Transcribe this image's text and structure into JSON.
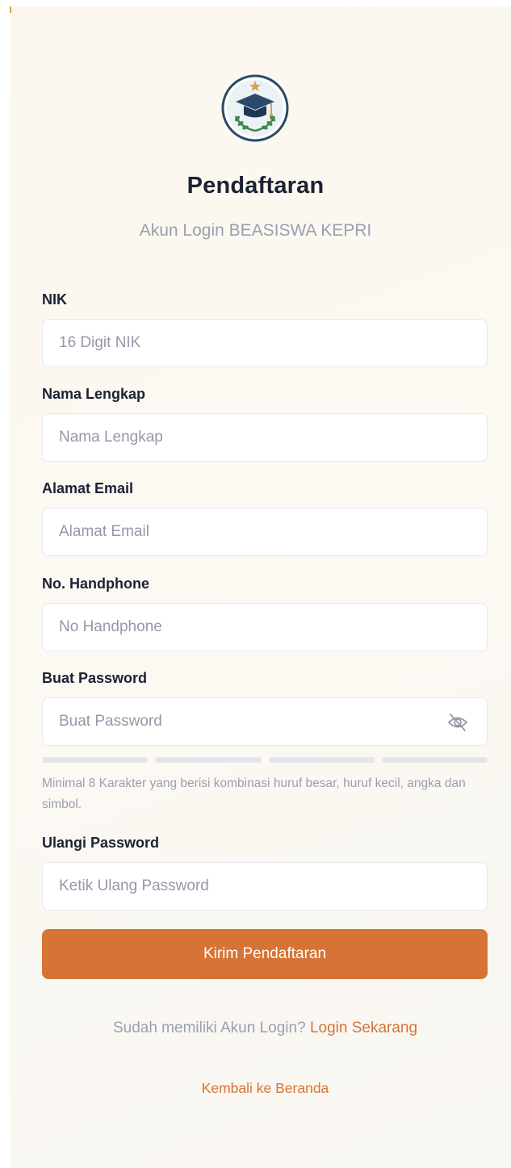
{
  "header": {
    "title": "Pendaftaran",
    "subtitle": "Akun Login BEASISWA KEPRI"
  },
  "form": {
    "nik": {
      "label": "NIK",
      "placeholder": "16 Digit NIK",
      "value": ""
    },
    "name": {
      "label": "Nama Lengkap",
      "placeholder": "Nama Lengkap",
      "value": ""
    },
    "email": {
      "label": "Alamat Email",
      "placeholder": "Alamat Email",
      "value": ""
    },
    "phone": {
      "label": "No. Handphone",
      "placeholder": "No Handphone",
      "value": ""
    },
    "password": {
      "label": "Buat Password",
      "placeholder": "Buat Password",
      "value": "",
      "toggle_icon": "eye-off-icon",
      "strength_level": 0,
      "strength_segments": 4,
      "hint": "Minimal 8 Karakter yang berisi kombinasi huruf besar, huruf kecil, angka dan simbol."
    },
    "confirm_password": {
      "label": "Ulangi Password",
      "placeholder": "Ketik Ulang Password",
      "value": ""
    },
    "submit_label": "Kirim Pendaftaran"
  },
  "footer": {
    "login_prompt": "Sudah memiliki Akun Login?",
    "login_link": "Login Sekarang",
    "back_link": "Kembali ke Beranda"
  },
  "colors": {
    "accent": "#d67435",
    "title": "#1c2133",
    "muted": "#9a9fb0",
    "logo_navy": "#2b4a6b",
    "logo_green": "#3f8a4a",
    "logo_gold": "#d4a24a"
  },
  "icons": {
    "logo": "graduation-cap-logo",
    "password_toggle": "eye-off-icon"
  }
}
